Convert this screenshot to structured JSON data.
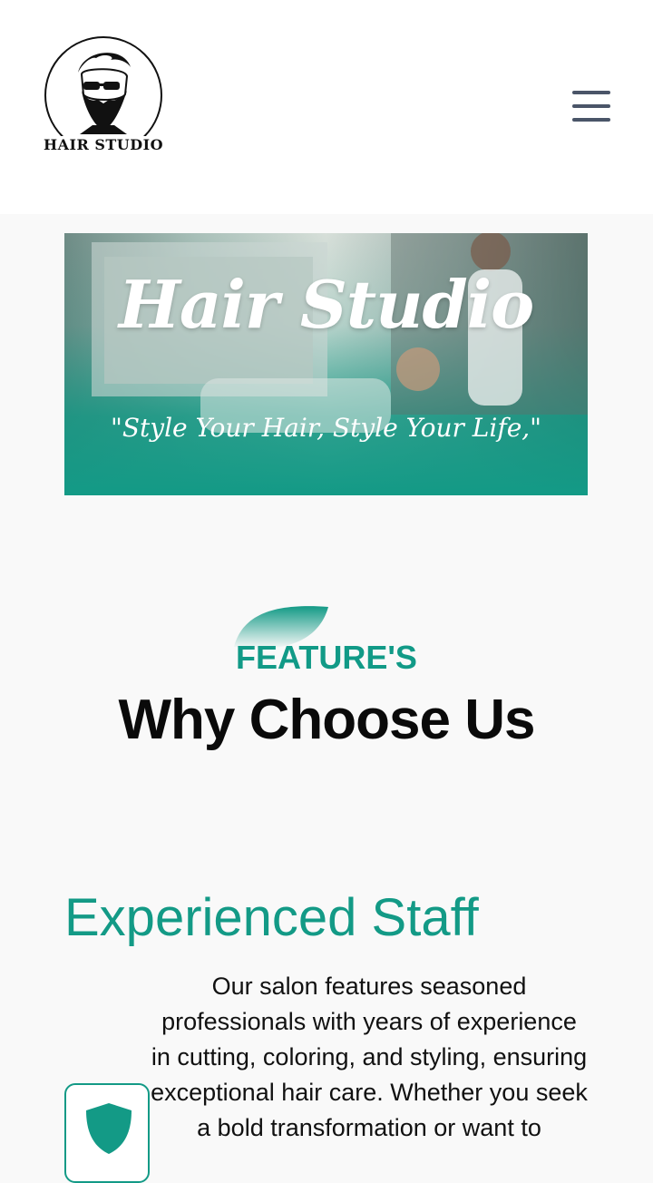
{
  "header": {
    "logo_text": "HAIR STUDIO",
    "menu_icon": "hamburger-menu-icon"
  },
  "hero": {
    "title": "Hair Studio",
    "tagline": "\"Style Your Hair, Style Your Life,\""
  },
  "features_section": {
    "eyebrow": "FEATURE'S",
    "title": "Why Choose Us"
  },
  "feature": {
    "title": "Experienced Staff",
    "description": "Our salon features seasoned professionals with years of experience in cutting, coloring, and styling, ensuring exceptional hair care. Whether you seek a bold transformation or want to",
    "icon": "shield-icon"
  },
  "colors": {
    "accent": "#139a86",
    "text": "#0a0a0a",
    "menu": "#4a5568",
    "background": "#f9f9f9"
  }
}
